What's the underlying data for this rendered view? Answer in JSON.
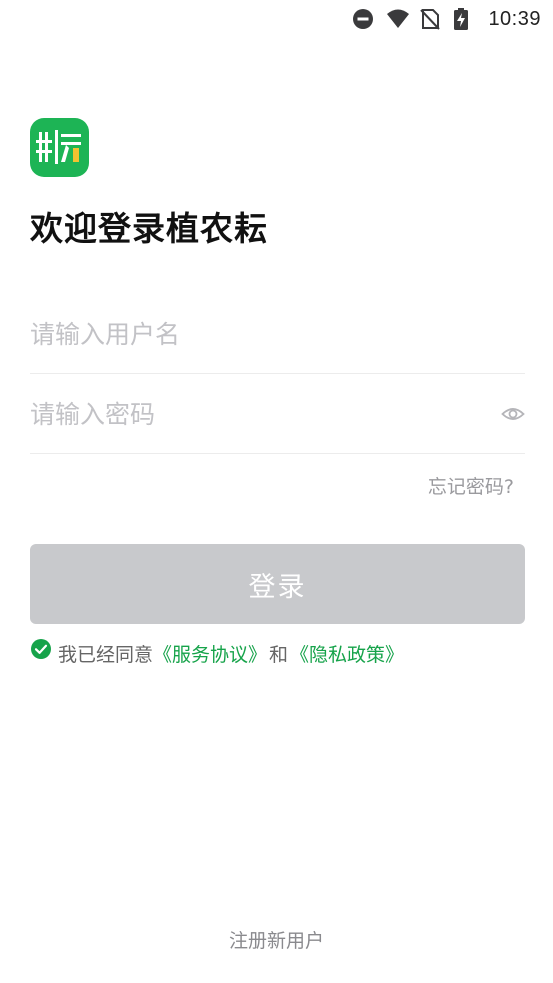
{
  "status_bar": {
    "time": "10:39",
    "icons": [
      "do-not-disturb-icon",
      "wifi-icon",
      "no-sim-icon",
      "battery-charging-icon"
    ]
  },
  "app": {
    "logo_icon": "app-logo-icon",
    "brand_color": "#1db455",
    "welcome_title": "欢迎登录植农耘"
  },
  "form": {
    "username_placeholder": "请输入用户名",
    "username_value": "",
    "password_placeholder": "请输入密码",
    "password_value": "",
    "password_toggle_icon": "eye-icon",
    "forgot_password": "忘记密码?",
    "login_label": "登录",
    "login_button_color": "#c8c9cc"
  },
  "agreement": {
    "checked": true,
    "prefix": "我已经同意",
    "service_link": "《服务协议》",
    "and_text": "和",
    "privacy_link": "《隐私政策》",
    "link_color": "#16a34a"
  },
  "footer": {
    "register": "注册新用户"
  }
}
